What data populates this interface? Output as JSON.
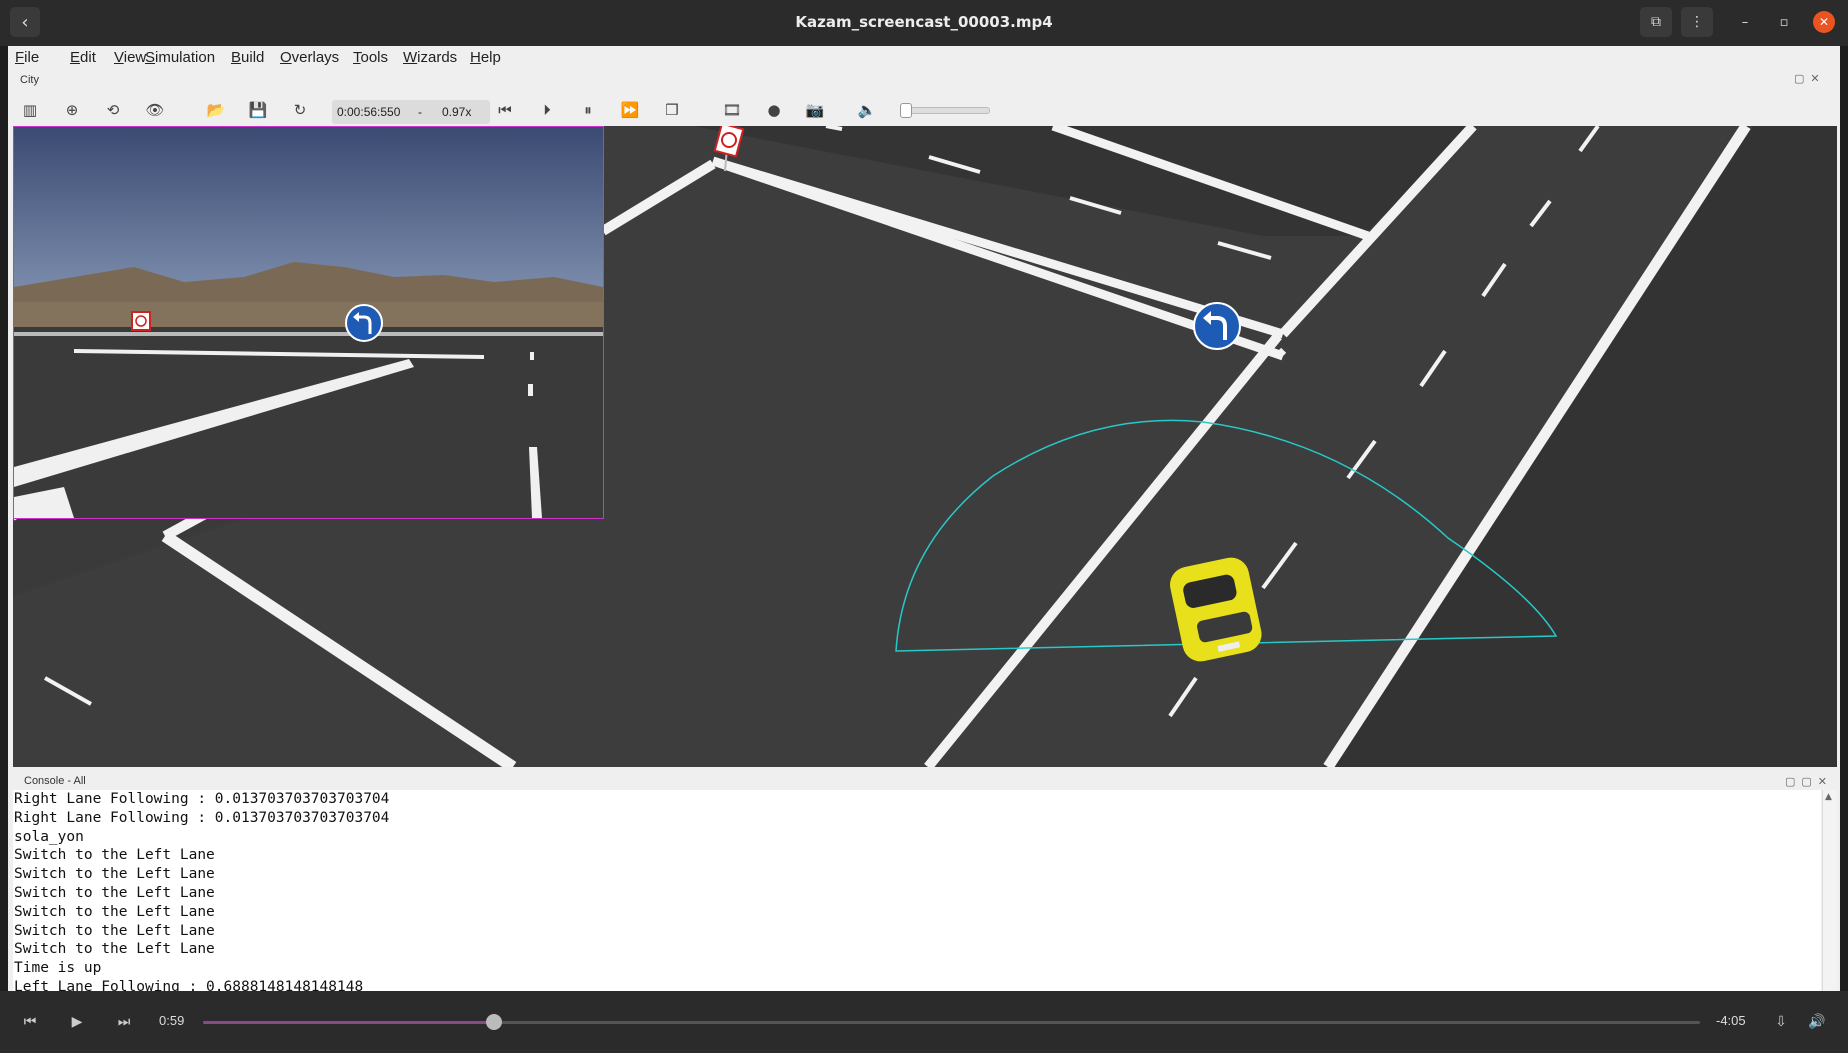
{
  "window": {
    "title": "Kazam_screencast_00003.mp4",
    "back_icon": "chevron-left-icon",
    "controls": [
      "picture-in-picture-icon",
      "menu-dots-icon",
      "minimize-icon",
      "maximize-icon",
      "close-icon"
    ]
  },
  "menubar": {
    "items": [
      "File",
      "Edit",
      "View",
      "Simulation",
      "Build",
      "Overlays",
      "Tools",
      "Wizards",
      "Help"
    ]
  },
  "scene_panel": {
    "label": "City"
  },
  "toolbar": {
    "time": "0:00:56:550",
    "separator": "-",
    "speed": "0.97x",
    "volume_level": 0
  },
  "console": {
    "label": "Console - All",
    "lines": [
      "Right Lane Following : 0.013703703703703704",
      "Right Lane Following : 0.013703703703703704",
      "sola_yon",
      "Switch to the Left Lane",
      "Switch to the Left Lane",
      "Switch to the Left Lane",
      "Switch to the Left Lane",
      "Switch to the Left Lane",
      "Switch to the Left Lane",
      "Time is up",
      "Left Lane Following : 0.6888148148148148"
    ]
  },
  "player": {
    "elapsed": "0:59",
    "remaining": "-4:05",
    "progress_fraction": 0.1947,
    "accent_color": "#8a4a8a"
  },
  "colors": {
    "titlebar": "#2b2b2b",
    "close_button": "#e95420",
    "camera_border": "#cc33cc",
    "lidar_arc": "#28c8c8",
    "car": "#e8e01a"
  }
}
